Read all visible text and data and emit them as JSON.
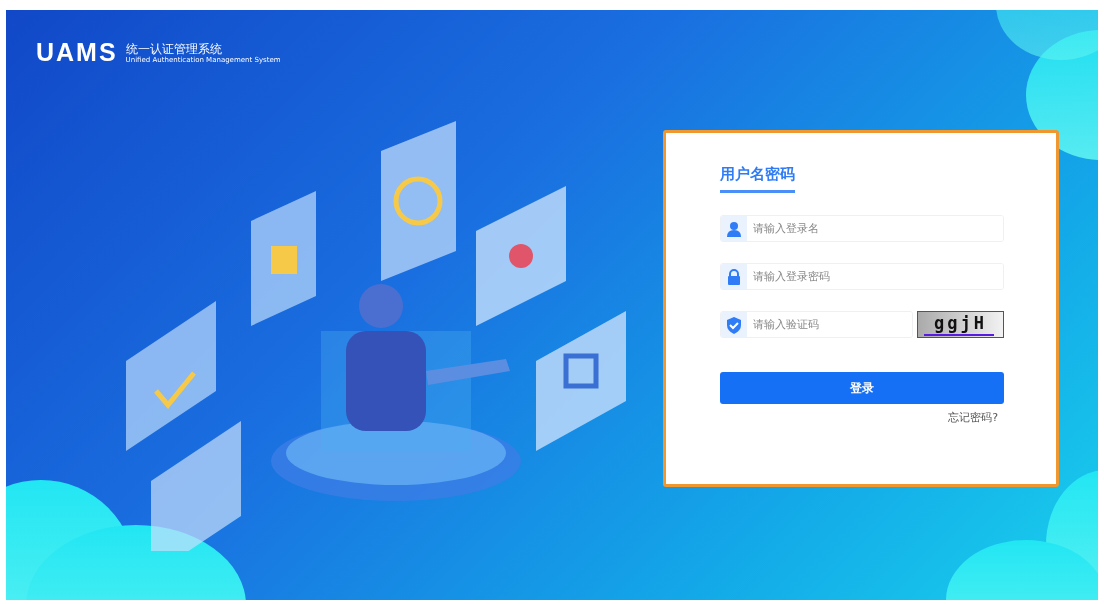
{
  "header": {
    "logo": "UAMS",
    "title": "统一认证管理系统",
    "subtitle": "Unified Authentication Management System"
  },
  "login": {
    "tabs": [
      {
        "label": "用户名密码",
        "selected": true
      }
    ],
    "fields": [
      {
        "kind": "user",
        "placeholder": "请输入登录名"
      },
      {
        "kind": "password",
        "placeholder": "请输入登录密码"
      },
      {
        "kind": "captcha",
        "placeholder": "请输入验证码",
        "captcha": "ggjH"
      }
    ],
    "submit": "登录",
    "forgot": "忘记密码?"
  }
}
